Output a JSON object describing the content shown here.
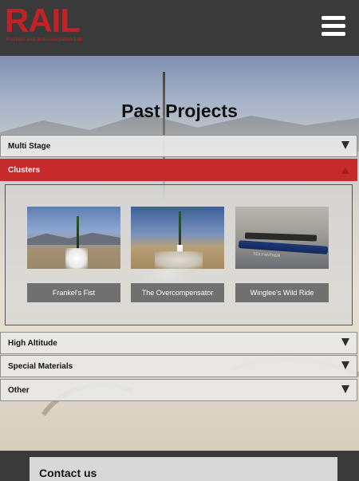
{
  "header": {
    "logo_text": "RAIL",
    "logo_subtitle": "Rockets and Instrumentation Lab",
    "menu_icon": "hamburger-menu-icon"
  },
  "hero": {
    "title": "Past Projects"
  },
  "accordion": [
    {
      "label": "Multi Stage",
      "expanded": false
    },
    {
      "label": "Clusters",
      "expanded": true
    },
    {
      "label": "High Altitude",
      "expanded": false
    },
    {
      "label": "Special Materials",
      "expanded": false
    },
    {
      "label": "Other",
      "expanded": false
    }
  ],
  "clusters": {
    "projects": [
      {
        "name": "Frankel's Fist"
      },
      {
        "name": "The Overcompensator"
      },
      {
        "name": "Winglee's Wild Ride"
      }
    ],
    "thumb3_text": "TEX FANTHER"
  },
  "footer": {
    "contact_label": "Contact us"
  },
  "colors": {
    "brand_red": "#c62a2a",
    "header_bg": "#3a3a3a",
    "button_gray": "#707070"
  }
}
